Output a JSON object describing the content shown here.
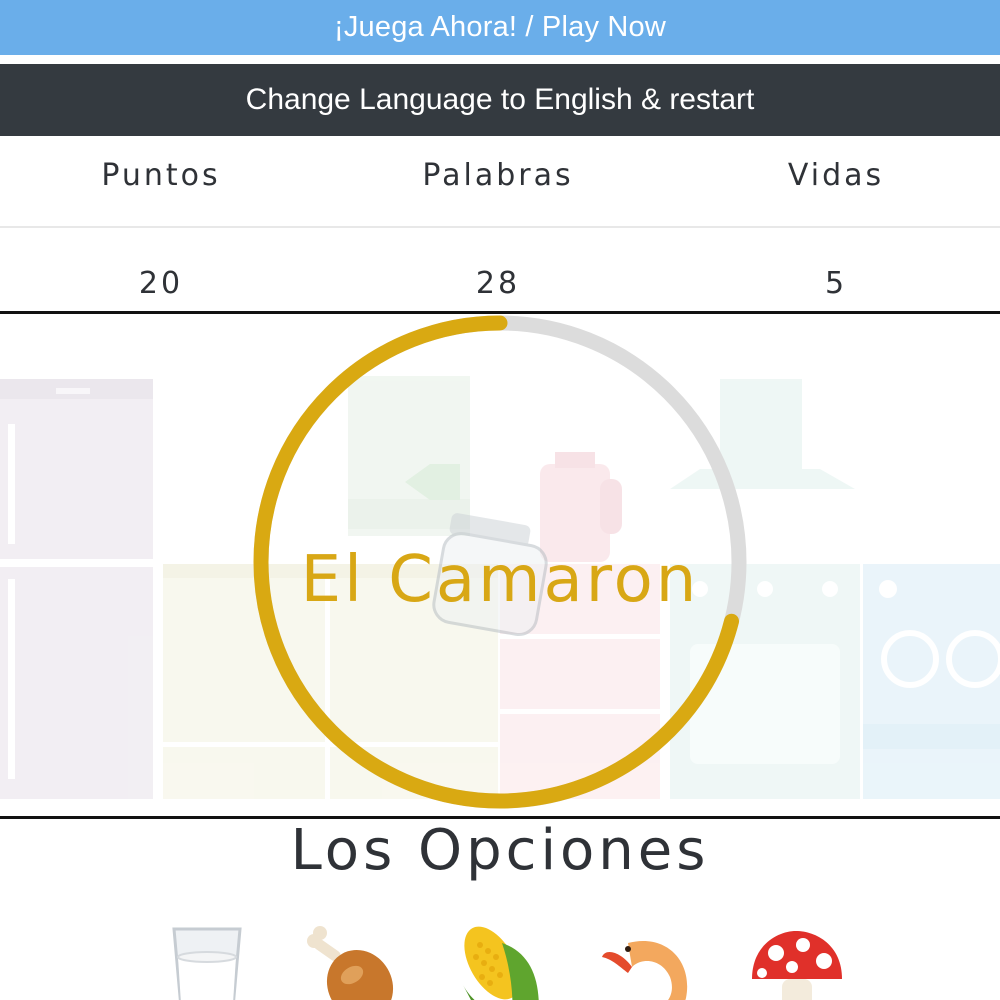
{
  "header": {
    "play_label": "¡Juega Ahora! / Play Now",
    "language_label": "Change Language to English & restart"
  },
  "stats": {
    "points_label": "Puntos",
    "words_label": "Palabras",
    "lives_label": "Vidas",
    "points_value": "20",
    "words_value": "28",
    "lives_value": "5"
  },
  "game": {
    "current_word": "El Camaron",
    "timer_fraction_remaining": 0.71,
    "timer_color": "#d9a912",
    "timer_track_color": "#dcdcdc"
  },
  "options": {
    "title": "Los Opciones",
    "items": [
      "milk-glass-icon",
      "chicken-leg-icon",
      "corn-icon",
      "shrimp-icon",
      "mushroom-icon"
    ]
  }
}
